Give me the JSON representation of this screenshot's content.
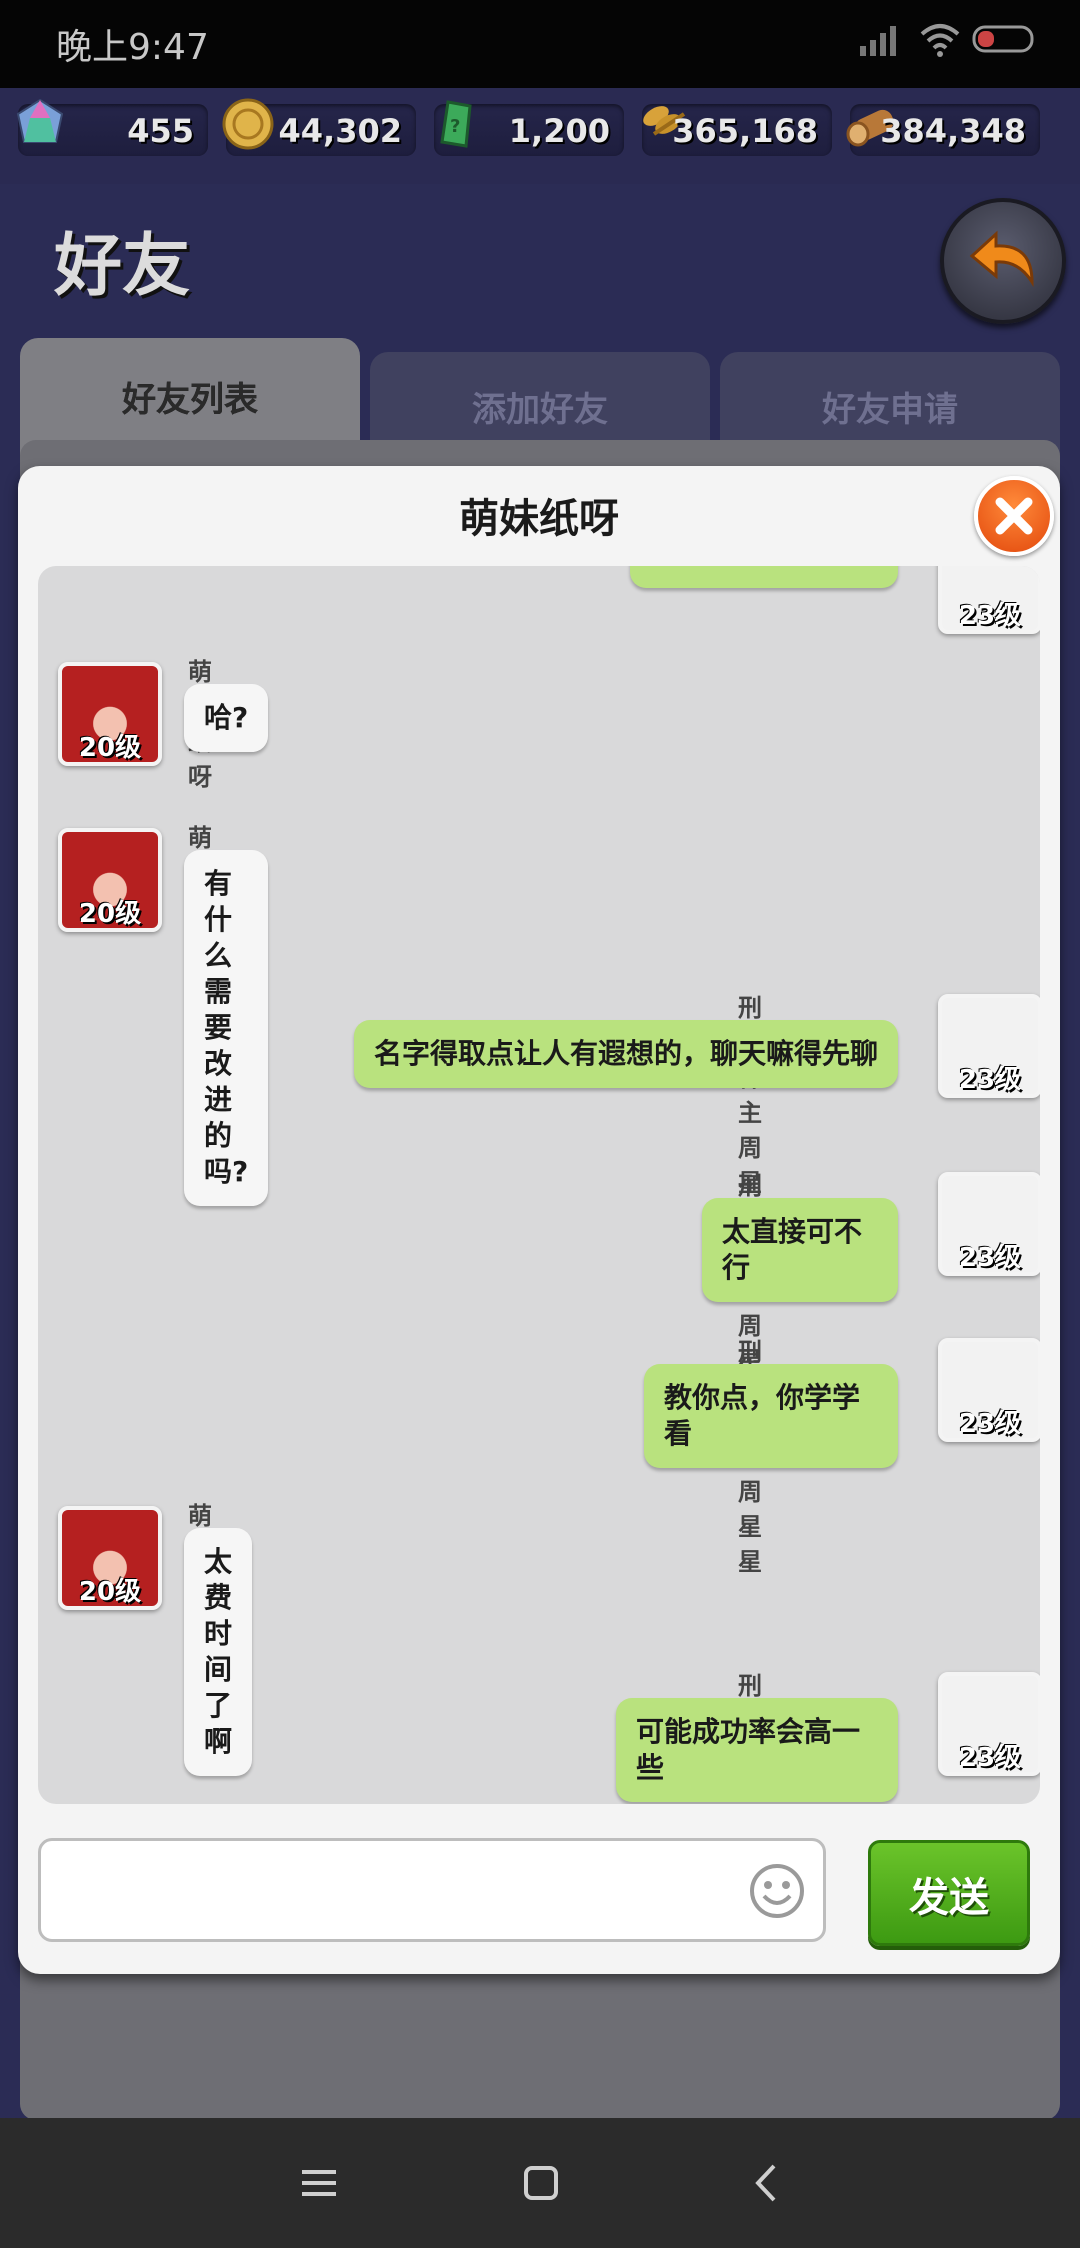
{
  "status_bar": {
    "time": "晚上9:47"
  },
  "resources": [
    {
      "icon": "gem-icon",
      "value": "455"
    },
    {
      "icon": "coin-icon",
      "value": "44,302"
    },
    {
      "icon": "green-crystal-icon",
      "value": "1,200"
    },
    {
      "icon": "wheat-icon",
      "value": "365,168"
    },
    {
      "icon": "wood-log-icon",
      "value": "384,348"
    }
  ],
  "header": {
    "title": "好友"
  },
  "tabs": [
    {
      "label": "好友列表",
      "active": true
    },
    {
      "label": "添加好友",
      "active": false
    },
    {
      "label": "好友申请",
      "active": false
    }
  ],
  "dialog": {
    "title": "萌妹纸呀",
    "messages": [
      {
        "side": "right",
        "sender": "",
        "text": "",
        "level": "23级",
        "partial": true
      },
      {
        "side": "left",
        "sender": "萌妹纸呀",
        "text": "哈?",
        "level": "20级"
      },
      {
        "side": "left",
        "sender": "萌妹纸呀",
        "text": "有什么需要改进的吗?",
        "level": "20级"
      },
      {
        "side": "right",
        "sender": "刑罚神主周星星",
        "text": "名字得取点让人有遐想的，聊天嘛得先聊",
        "level": "23级"
      },
      {
        "side": "right",
        "sender": "刑罚神主周星星",
        "text": "太直接可不行",
        "level": "23级"
      },
      {
        "side": "right",
        "sender": "刑罚神主周星星",
        "text": "教你点，你学学看",
        "level": "23级"
      },
      {
        "side": "left",
        "sender": "萌妹纸呀",
        "text": "太费时间了啊",
        "level": "20级"
      },
      {
        "side": "right",
        "sender": "刑罚神主周星星",
        "text": "可能成功率会高一些",
        "level": "23级"
      }
    ],
    "input": {
      "value": "",
      "placeholder": ""
    },
    "send_label": "发送"
  },
  "colors": {
    "accent_green": "#3d9a12",
    "close_orange": "#e2480c",
    "bubble_right": "#b9e27e"
  }
}
